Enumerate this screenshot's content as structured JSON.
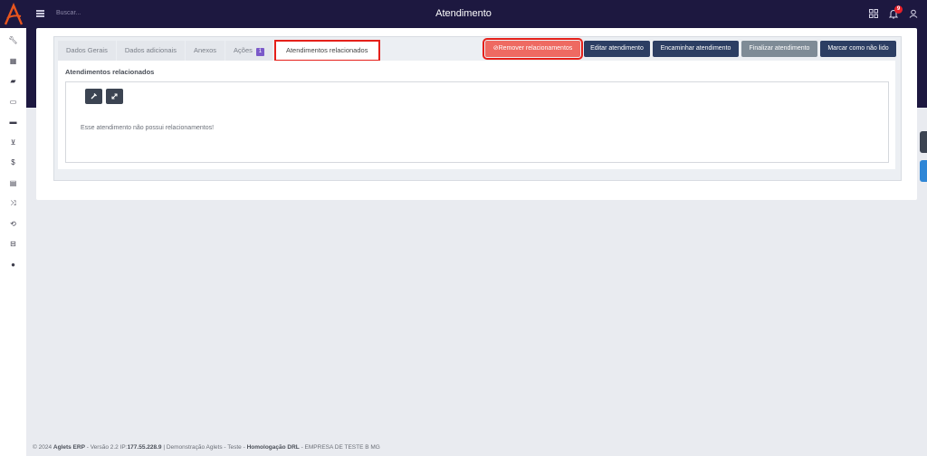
{
  "header": {
    "title": "Atendimento",
    "search_placeholder": "Buscar...",
    "notification_count": "9"
  },
  "sidebar": {
    "icons": [
      "wrench-icon",
      "calculator-icon",
      "book-icon",
      "cash-icon",
      "briefcase-icon",
      "cart-icon",
      "dollar-icon",
      "table-icon",
      "shuffle-icon",
      "repeat-icon",
      "basket-icon",
      "user-icon"
    ]
  },
  "tabs": [
    {
      "label": "Dados Gerais"
    },
    {
      "label": "Dados adicionais"
    },
    {
      "label": "Anexos"
    },
    {
      "label": "Ações",
      "count": "1"
    },
    {
      "label": "Atendimentos relacionados"
    }
  ],
  "actions": {
    "remove": "Remover relacionamentos",
    "edit": "Editar atendimento",
    "forward": "Encaminhar atendimento",
    "finish": "Finalizar atendimento",
    "mark_unread": "Marcar como não lido"
  },
  "section": {
    "title": "Atendimentos relacionados",
    "empty_message": "Esse atendimento não possui relacionamentos!"
  },
  "footer": {
    "prefix": "© 2024",
    "brand": "Aglets ERP",
    "version": "- Versão 2.2",
    "ip_label": "IP:",
    "ip": "177.55.228.9",
    "env": "| Demonstração Aglets - Teste -",
    "env_name": "Homologação DRL",
    "company": "- EMPRESA DE TESTE B MG"
  },
  "colors": {
    "header_bg": "#1d1840",
    "accent_red": "#e5201a",
    "button_dark": "#2c3e63",
    "badge_purple": "#7b5ac9"
  }
}
